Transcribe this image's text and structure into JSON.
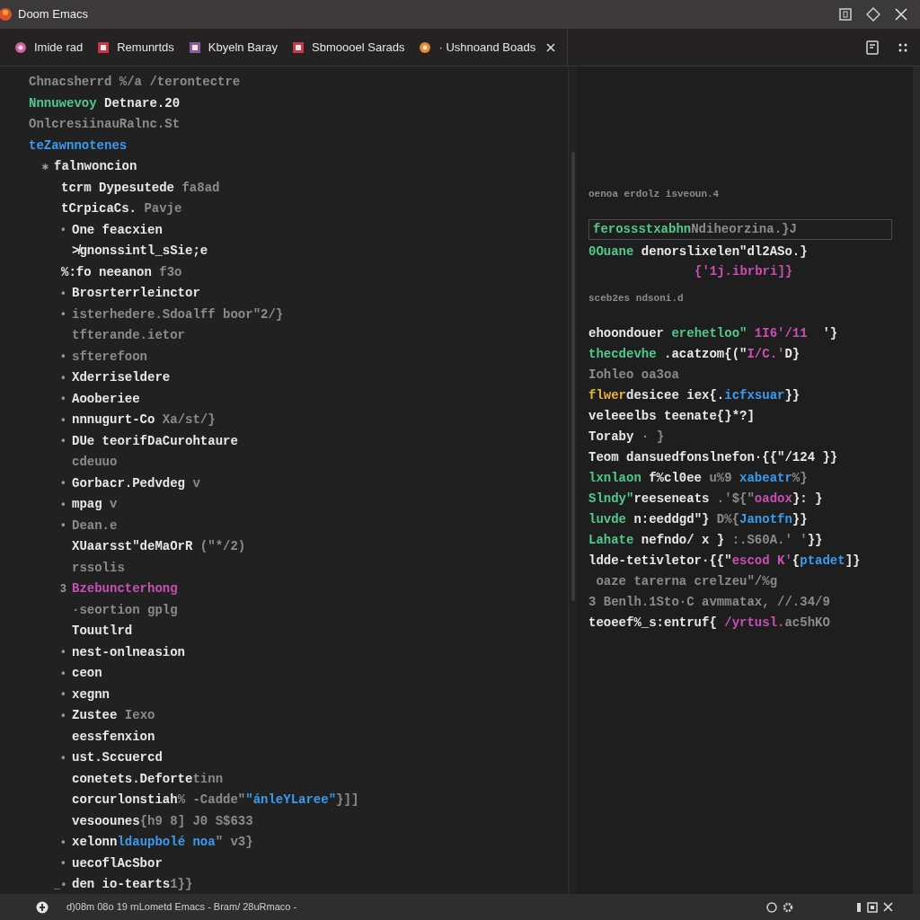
{
  "window": {
    "title": "Doom Emacs"
  },
  "tabs": [
    {
      "label": "Imide rad",
      "color": "#d35fa0",
      "closable": false
    },
    {
      "label": "Remunrtds",
      "color": "#c9364c",
      "closable": false
    },
    {
      "label": "Kbyeln Baray",
      "color": "#8a5a9a",
      "closable": false
    },
    {
      "label": "Sbmoooel Sarads",
      "color": "#c83a4a",
      "closable": false
    },
    {
      "label": "· Ushnoand Boads",
      "color": "#e58a2a",
      "closable": true
    }
  ],
  "editor": {
    "lines": [
      {
        "kind": "flush",
        "segments": [
          {
            "color": "#8c8b8b",
            "text": "Chnacsherrd %/a /terontectre"
          }
        ]
      },
      {
        "kind": "flush",
        "segments": [
          {
            "color": "#52c98c",
            "text": "Nnnuwevoy"
          },
          {
            "color": "#e8e8e8",
            "text": " Detnare.20"
          }
        ]
      },
      {
        "kind": "flush",
        "segments": [
          {
            "color": "#8c8b8b",
            "text": "OnlcresiinauRalnc.St"
          }
        ]
      },
      {
        "kind": "flush",
        "segments": [
          {
            "color": "#3a9cf0",
            "text": "teZawnnotenes"
          }
        ]
      },
      {
        "kind": "deep",
        "marker": "✱",
        "segments": [
          {
            "color": "#e8e8e8",
            "text": "falnwoncion"
          }
        ]
      },
      {
        "kind": "sub",
        "segments": [
          {
            "color": "#e8e8e8",
            "text": "tcrm Dypesutede"
          },
          {
            "color": "#8c8b8b",
            "text": " fa8ad"
          }
        ]
      },
      {
        "kind": "sub",
        "segments": [
          {
            "color": "#e8e8e8",
            "text": "tCrpicaCs."
          },
          {
            "color": "#8c8b8b",
            "text": " Pavje"
          }
        ]
      },
      {
        "kind": "item",
        "marker": "•",
        "segments": [
          {
            "color": "#e8e8e8",
            "text": "One feacxien"
          }
        ]
      },
      {
        "kind": "item",
        "segments": [
          {
            "color": "#e8e8e8",
            "text": "≯gnonssintl_sSie;e"
          }
        ]
      },
      {
        "kind": "sub",
        "segments": [
          {
            "color": "#e8e8e8",
            "text": "%:fo neeanon"
          },
          {
            "color": "#8c8b8b",
            "text": " f3o"
          }
        ]
      },
      {
        "kind": "item",
        "marker": "•",
        "segments": [
          {
            "color": "#e8e8e8",
            "text": "Brosrterrleinctor"
          }
        ]
      },
      {
        "kind": "item",
        "marker": "•",
        "segments": [
          {
            "color": "#8c8b8b",
            "text": "isterhedere.Sdoalff boor\"2/}"
          }
        ]
      },
      {
        "kind": "item",
        "segments": [
          {
            "color": "#8c8b8b",
            "text": "tfterande.ietor"
          }
        ]
      },
      {
        "kind": "item",
        "marker": "•",
        "segments": [
          {
            "color": "#8c8b8b",
            "text": "sfterefoon"
          }
        ]
      },
      {
        "kind": "item",
        "marker": "•",
        "segments": [
          {
            "color": "#e8e8e8",
            "text": "Xderriseldere"
          }
        ]
      },
      {
        "kind": "item",
        "marker": "•",
        "segments": [
          {
            "color": "#e8e8e8",
            "text": "Aooberiee"
          }
        ]
      },
      {
        "kind": "item",
        "marker": "•",
        "segments": [
          {
            "color": "#e8e8e8",
            "text": "nnnugurt-Co"
          },
          {
            "color": "#8c8b8b",
            "text": " Xa/st/}"
          }
        ]
      },
      {
        "kind": "item",
        "marker": "•",
        "segments": [
          {
            "color": "#e8e8e8",
            "text": "DUe teorifDaCurohtaure"
          }
        ]
      },
      {
        "kind": "item",
        "segments": [
          {
            "color": "#8c8b8b",
            "text": "cdeuuo"
          }
        ]
      },
      {
        "kind": "item",
        "marker": "•",
        "segments": [
          {
            "color": "#e8e8e8",
            "text": "Gorbacr.Pedvdeg"
          },
          {
            "color": "#8c8b8b",
            "text": " v"
          }
        ]
      },
      {
        "kind": "item",
        "marker": "•",
        "segments": [
          {
            "color": "#e8e8e8",
            "text": "mpag"
          },
          {
            "color": "#8c8b8b",
            "text": " v"
          }
        ]
      },
      {
        "kind": "item",
        "marker": "•",
        "segments": [
          {
            "color": "#8c8b8b",
            "text": "Dean.e"
          }
        ]
      },
      {
        "kind": "item",
        "segments": [
          {
            "color": "#e8e8e8",
            "text": "XUaarsst\"deMaOrR"
          },
          {
            "color": "#8c8b8b",
            "text": " (\"*/2)"
          }
        ]
      },
      {
        "kind": "item",
        "segments": [
          {
            "color": "#8c8b8b",
            "text": "rssolis"
          }
        ]
      },
      {
        "kind": "item",
        "marker": "3",
        "segments": [
          {
            "color": "#c94fb5",
            "text": "Bzebuncterhong"
          }
        ]
      },
      {
        "kind": "item",
        "segments": [
          {
            "color": "#8c8b8b",
            "text": "·seortion gplg"
          }
        ]
      },
      {
        "kind": "item",
        "segments": [
          {
            "color": "#e8e8e8",
            "text": "Touutlrd"
          }
        ]
      },
      {
        "kind": "item",
        "marker": "•",
        "segments": [
          {
            "color": "#e8e8e8",
            "text": "nest-onlneasion"
          }
        ]
      },
      {
        "kind": "item",
        "marker": "•",
        "segments": [
          {
            "color": "#e8e8e8",
            "text": "ceon"
          }
        ]
      },
      {
        "kind": "item",
        "marker": "•",
        "segments": [
          {
            "color": "#e8e8e8",
            "text": "xegnn"
          }
        ]
      },
      {
        "kind": "item",
        "marker": "•",
        "segments": [
          {
            "color": "#e8e8e8",
            "text": "Zustee"
          },
          {
            "color": "#8c8b8b",
            "text": " Iexo"
          }
        ]
      },
      {
        "kind": "item",
        "segments": [
          {
            "color": "#e8e8e8",
            "text": "eessfenxion"
          }
        ]
      },
      {
        "kind": "item",
        "marker": "•",
        "segments": [
          {
            "color": "#e8e8e8",
            "text": "ust.Sccuercd"
          }
        ]
      },
      {
        "kind": "item",
        "segments": [
          {
            "color": "#e8e8e8",
            "text": "conetets.Deforte"
          },
          {
            "color": "#8c8b8b",
            "text": "tinn"
          }
        ]
      },
      {
        "kind": "item",
        "segments": [
          {
            "color": "#e8e8e8",
            "text": "corcurlonstiah"
          },
          {
            "color": "#8c8b8b",
            "text": "% -Cadde\""
          },
          {
            "color": "#3a9cf0",
            "text": "\"ánleYLaree\""
          },
          {
            "color": "#8c8b8b",
            "text": "}]]"
          }
        ]
      },
      {
        "kind": "item",
        "segments": [
          {
            "color": "#e8e8e8",
            "text": "vesoounes"
          },
          {
            "color": "#8c8b8b",
            "text": "{h9 8] J0 S$633"
          }
        ]
      },
      {
        "kind": "item",
        "marker": "•",
        "segments": [
          {
            "color": "#e8e8e8",
            "text": "xelonn"
          },
          {
            "color": "#3a9cf0",
            "text": "ldaupbolé noa"
          },
          {
            "color": "#8c8b8b",
            "text": "\" v3}"
          }
        ]
      },
      {
        "kind": "item",
        "marker": "•",
        "segments": [
          {
            "color": "#e8e8e8",
            "text": "uecoflAcSbor"
          }
        ]
      },
      {
        "kind": "item",
        "marker": "_•",
        "segments": [
          {
            "color": "#e8e8e8",
            "text": "den io-tearts"
          },
          {
            "color": "#8c8b8b",
            "text": "1}}"
          }
        ]
      }
    ]
  },
  "side_pane": {
    "lines": [
      {
        "kind": "tiny",
        "segments": [
          {
            "color": "#8c8b8b",
            "text": "oenoa erdolz isveoun.4"
          }
        ]
      },
      {
        "kind": "boxed",
        "segments": [
          {
            "color": "#52c98c",
            "text": "ferossstxabhn"
          },
          {
            "color": "#8c8b8b",
            "text": "Ndiheorzina.}J"
          }
        ]
      },
      {
        "kind": "code",
        "segments": [
          {
            "color": "#52c98c",
            "text": "0Ouane"
          },
          {
            "color": "#e8e8e8",
            "text": " denorslixelen\"dl2ASo.}"
          }
        ]
      },
      {
        "kind": "indented",
        "segments": [
          {
            "color": "#c94fb5",
            "text": "{'1j.ibrbri]}"
          }
        ]
      },
      {
        "kind": "tiny",
        "segments": [
          {
            "color": "#8c8b8b",
            "text": "sceb2es ndsoni.d"
          }
        ]
      },
      {
        "kind": "code",
        "segments": [
          {
            "color": "#e8e8e8",
            "text": "ehoondouer "
          },
          {
            "color": "#52c98c",
            "text": "erehetloo\""
          },
          {
            "color": "#c94fb5",
            "text": " 1I6'/11"
          },
          {
            "color": "#e8e8e8",
            "text": "  '}"
          }
        ]
      },
      {
        "kind": "code",
        "segments": [
          {
            "color": "#52c98c",
            "text": "thecdevhe"
          },
          {
            "color": "#e8e8e8",
            "text": " .acatzom{(\""
          },
          {
            "color": "#c94fb5",
            "text": "I/C.'"
          },
          {
            "color": "#e8e8e8",
            "text": "D}"
          }
        ]
      },
      {
        "kind": "code",
        "segments": [
          {
            "color": "#8c8b8b",
            "text": "Iohleo oa3oa"
          }
        ]
      },
      {
        "kind": "code",
        "segments": [
          {
            "color": "#e9b33a",
            "text": "flwer"
          },
          {
            "color": "#e8e8e8",
            "text": "desicee iex{."
          },
          {
            "color": "#3a9cf0",
            "text": "icfxsuar"
          },
          {
            "color": "#e8e8e8",
            "text": "}}"
          }
        ]
      },
      {
        "kind": "code",
        "segments": [
          {
            "color": "#e8e8e8",
            "text": "veleeelbs teenate{}*?]"
          }
        ]
      },
      {
        "kind": "code",
        "segments": [
          {
            "color": "#e8e8e8",
            "text": "Toraby"
          },
          {
            "color": "#8c8b8b",
            "text": " · }"
          }
        ]
      },
      {
        "kind": "code",
        "segments": [
          {
            "color": "#e8e8e8",
            "text": "Teom dansuedfonslnefon·{{\"/124 }}"
          }
        ]
      },
      {
        "kind": "code",
        "segments": [
          {
            "color": "#52c98c",
            "text": "lxnlaon"
          },
          {
            "color": "#e8e8e8",
            "text": " f%cl0ee"
          },
          {
            "color": "#8c8b8b",
            "text": " u%9"
          },
          {
            "color": "#3a9cf0",
            "text": " xabeatr"
          },
          {
            "color": "#8c8b8b",
            "text": "%}"
          }
        ]
      },
      {
        "kind": "code",
        "segments": [
          {
            "color": "#52c98c",
            "text": "Slndy\""
          },
          {
            "color": "#e8e8e8",
            "text": "reeseneats"
          },
          {
            "color": "#8c8b8b",
            "text": " .'${\""
          },
          {
            "color": "#c94fb5",
            "text": "oadox"
          },
          {
            "color": "#e8e8e8",
            "text": "}: }"
          }
        ]
      },
      {
        "kind": "code",
        "segments": [
          {
            "color": "#52c98c",
            "text": "luvde"
          },
          {
            "color": "#e8e8e8",
            "text": " n:eeddgd\"}"
          },
          {
            "color": "#8c8b8b",
            "text": " D%{"
          },
          {
            "color": "#3a9cf0",
            "text": "Janotfn"
          },
          {
            "color": "#e8e8e8",
            "text": "}}"
          }
        ]
      },
      {
        "kind": "code",
        "segments": [
          {
            "color": "#52c98c",
            "text": "Lahate"
          },
          {
            "color": "#e8e8e8",
            "text": " nefndo/ x }"
          },
          {
            "color": "#8c8b8b",
            "text": " :.S60A.' '"
          },
          {
            "color": "#e8e8e8",
            "text": "}}"
          }
        ]
      },
      {
        "kind": "code",
        "segments": [
          {
            "color": "#e8e8e8",
            "text": "ldde-tetivletor·{{\""
          },
          {
            "color": "#c94fb5",
            "text": "escod K'"
          },
          {
            "color": "#e8e8e8",
            "text": "{"
          },
          {
            "color": "#3a9cf0",
            "text": "ptadet"
          },
          {
            "color": "#e8e8e8",
            "text": "]}"
          }
        ]
      },
      {
        "kind": "code",
        "segments": [
          {
            "color": "#8c8b8b",
            "text": " oaze tarerna crelzeu\"/%g"
          }
        ]
      },
      {
        "kind": "code",
        "segments": [
          {
            "color": "#8c8b8b",
            "text": "3 Benlh.1Sto·C avmmatax, //.34/9"
          }
        ]
      },
      {
        "kind": "code",
        "segments": [
          {
            "color": "#e8e8e8",
            "text": "teoeef%_s:entruf{"
          },
          {
            "color": "#c94fb5",
            "text": " /yrtusl."
          },
          {
            "color": "#8c8b8b",
            "text": "ac5hKO"
          }
        ]
      }
    ]
  },
  "status_bar": {
    "text": "d)08m 08o 19 rnLometd Emacs - Bram/ 28uRmaco -"
  }
}
